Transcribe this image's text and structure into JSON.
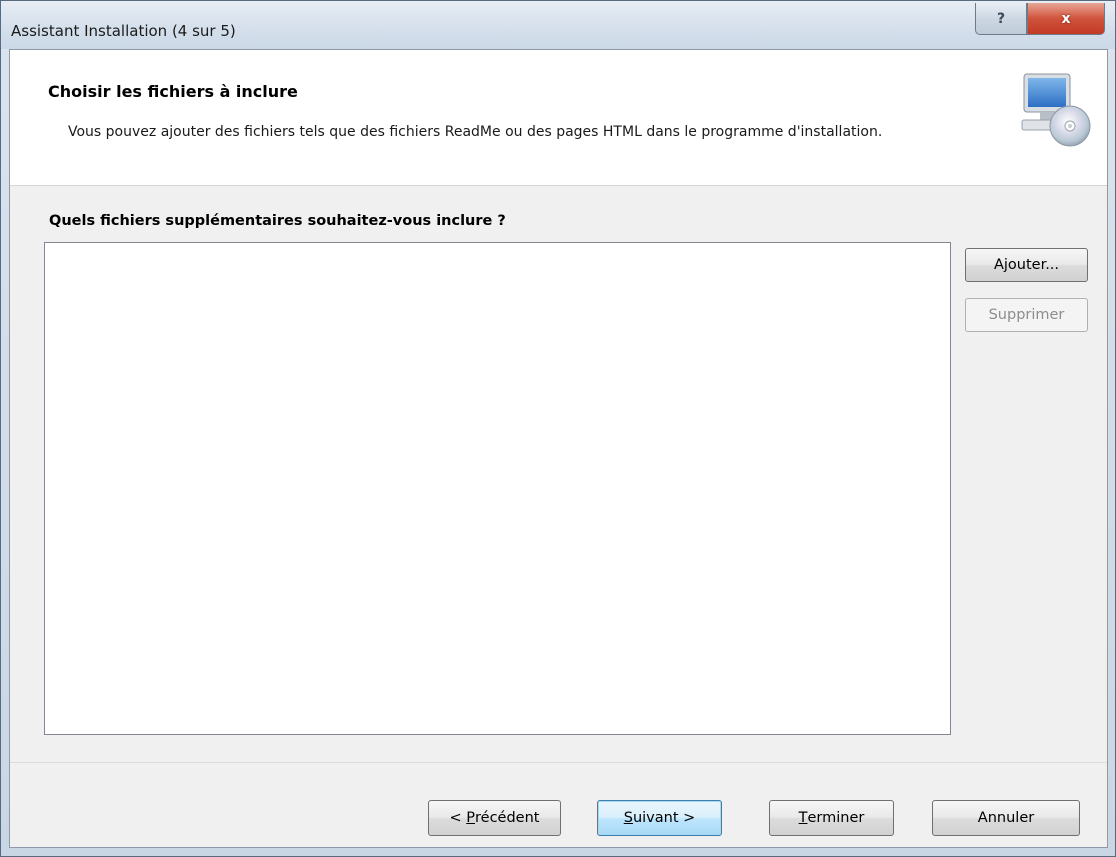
{
  "window": {
    "title": "Assistant Installation (4 sur 5)",
    "help_glyph": "?",
    "close_glyph": "x"
  },
  "header": {
    "title": "Choisir les fichiers à inclure",
    "description": "Vous pouvez ajouter des fichiers tels que des fichiers ReadMe ou des pages HTML dans le programme d'installation.",
    "icon": "computer-cd-icon"
  },
  "content": {
    "question": "Quels fichiers supplémentaires souhaitez-vous inclure ?",
    "files": []
  },
  "side_buttons": {
    "add": "Ajouter...",
    "remove": "Supprimer"
  },
  "footer": {
    "previous": {
      "prefix": "< ",
      "accel": "P",
      "rest": "récédent"
    },
    "next": {
      "prefix": "",
      "accel": "S",
      "rest": "uivant >"
    },
    "finish": {
      "prefix": "",
      "accel": "T",
      "rest": "erminer"
    },
    "cancel": "Annuler"
  },
  "colors": {
    "accent_default_button": "#3c7fb1",
    "close_button": "#c23a24"
  }
}
